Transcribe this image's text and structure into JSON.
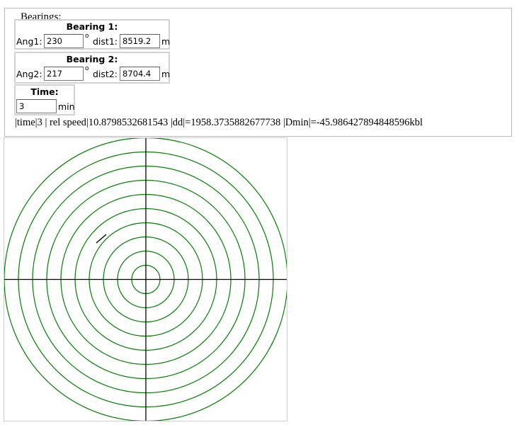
{
  "bearings_form": {
    "legend": "Bearings:",
    "bearing1": {
      "title": "Bearing 1:",
      "ang_label": "Ang1:",
      "ang_value": "230",
      "deg_symbol": "o",
      "dist_label": "dist1:",
      "dist_value": "8519.2",
      "dist_unit": "m"
    },
    "bearing2": {
      "title": "Bearing 2:",
      "ang_label": "Ang2:",
      "ang_value": "217",
      "deg_symbol": "o",
      "dist_label": "dist2:",
      "dist_value": "8704.4",
      "dist_unit": "m"
    },
    "time": {
      "title": "Time:",
      "value": "3",
      "unit": "min"
    }
  },
  "result_line": {
    "time_label": "|time|",
    "time_value": "3",
    "speed_label": " | rel speed|",
    "speed_value": "10.8798532681543",
    "dd_label": " |dd|=",
    "dd_value": "1958.3735882677738",
    "dmin_label": " |Dmin|=",
    "dmin_value": "-45.986427894848596",
    "dmin_unit": "kbl"
  },
  "radar": {
    "ring_count": 10,
    "ring_color": "#008000",
    "axis_color": "#000000",
    "track_segment": {
      "description": "short line segment plotted in upper-left quadrant",
      "color": "#000000"
    }
  }
}
